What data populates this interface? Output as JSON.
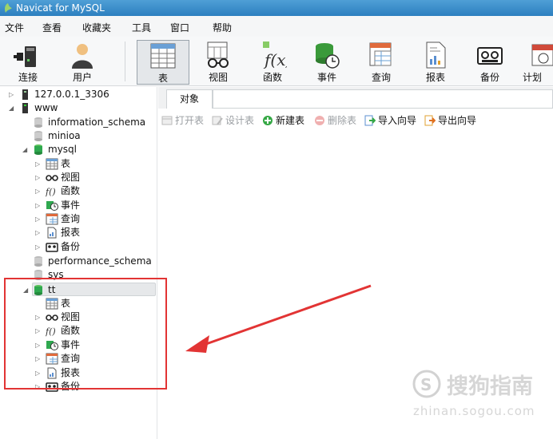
{
  "window": {
    "title": "Navicat for MySQL"
  },
  "menu": [
    "文件",
    "查看",
    "收藏夹",
    "工具",
    "窗口",
    "帮助"
  ],
  "toolbar": {
    "items": [
      {
        "label": "连接",
        "icon": "plug-connect-icon"
      },
      {
        "label": "用户",
        "icon": "user-icon"
      },
      {
        "label": "表",
        "icon": "table-icon",
        "active": true
      },
      {
        "label": "视图",
        "icon": "glasses-view-icon"
      },
      {
        "label": "函数",
        "icon": "function-icon"
      },
      {
        "label": "事件",
        "icon": "event-clock-icon"
      },
      {
        "label": "查询",
        "icon": "query-icon"
      },
      {
        "label": "报表",
        "icon": "report-icon"
      },
      {
        "label": "备份",
        "icon": "backup-tape-icon"
      },
      {
        "label": "计划",
        "icon": "schedule-calendar-icon"
      }
    ]
  },
  "tree": {
    "connection1": "127.0.0.1_3306",
    "connection2": "www",
    "databases": {
      "information_schema": "information_schema",
      "minioa": "minioa",
      "mysql": "mysql",
      "performance_schema": "performance_schema",
      "sys": "sys",
      "tt": "tt"
    },
    "children": {
      "table": "表",
      "view": "视图",
      "function": "函数",
      "event": "事件",
      "query": "查询",
      "report": "报表",
      "backup": "备份"
    }
  },
  "object_tab": {
    "label": "对象"
  },
  "actions": {
    "open": "打开表",
    "design": "设计表",
    "new": "新建表",
    "delete": "删除表",
    "import": "导入向导",
    "export": "导出向导"
  },
  "watermark": {
    "title": "搜狗指南",
    "url": "zhinan.sogou.com"
  },
  "colors": {
    "annotation_red": "#e23434",
    "db_green": "#2fa84f",
    "titlebar_blue": "#2c7fbf"
  }
}
